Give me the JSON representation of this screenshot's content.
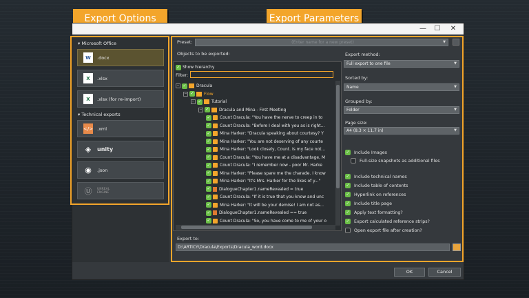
{
  "callouts": {
    "export_options": "Export Options",
    "export_parameters": "Export Parameters"
  },
  "window": {
    "minimize": "—",
    "maximize": "☐",
    "close": "✕"
  },
  "left": {
    "office_head": "▾ Microsoft Office",
    "technical_head": "▾ Technical exports",
    "formats": [
      {
        "label": ".docx",
        "icon": "word-icon"
      },
      {
        "label": ".xlsx",
        "icon": "excel-icon"
      },
      {
        "label": ".xlsx (for re-import)",
        "icon": "excel-icon"
      },
      {
        "label": ".xml",
        "icon": "xml-icon"
      },
      {
        "label": "unity",
        "icon": "unity-icon"
      },
      {
        "label": ".json",
        "icon": "json-icon"
      },
      {
        "label": "UNREAL ENGINE",
        "icon": "unreal-icon"
      }
    ]
  },
  "preset": {
    "label": "Preset:",
    "placeholder": "(Enter name for a new preset)"
  },
  "objects": {
    "label": "Objects to be exported:",
    "show_hierarchy": "Show hierarchy",
    "filter_label": "Filter:"
  },
  "tree": [
    {
      "level": 0,
      "pm": "⊟",
      "icon": "project",
      "text": "Dracula"
    },
    {
      "level": 1,
      "pm": "⊟",
      "icon": "flow",
      "text": "Flow",
      "orange": true
    },
    {
      "level": 2,
      "pm": "⊟",
      "icon": "folder",
      "text": "Tutorial"
    },
    {
      "level": 3,
      "pm": "⊟",
      "icon": "dialogue",
      "text": "Dracula and Mina - First Meeting"
    },
    {
      "level": 4,
      "icon": "line",
      "text": "Count Dracula: \"You have the nerve to creep in to"
    },
    {
      "level": 4,
      "icon": "line",
      "text": "Count Dracula: \"Before I deal with you as is right..."
    },
    {
      "level": 4,
      "icon": "line",
      "text": "Mina Harker: \"Dracula speaking about courtesy? Y"
    },
    {
      "level": 4,
      "icon": "line",
      "text": "Mina Harker: \"You are not deserving of any courte"
    },
    {
      "level": 4,
      "icon": "line",
      "text": "Mina Harker: \"Look closely, Count. Is my face not..."
    },
    {
      "level": 4,
      "icon": "line",
      "text": "Count Dracula: \"You have me at a disadvantage, M"
    },
    {
      "level": 4,
      "icon": "line",
      "text": "Count Dracula: \"I remember now - poor Mr. Harke"
    },
    {
      "level": 4,
      "icon": "line",
      "text": "Mina Harker: \"Please spare me the charade. I know"
    },
    {
      "level": 4,
      "icon": "line",
      "text": "Mina Harker: \"It's Mrs. Harker for the likes of y...\""
    },
    {
      "level": 4,
      "icon": "instr",
      "text": "DialogueChapter1.nameRevealed = true"
    },
    {
      "level": 4,
      "icon": "line",
      "text": "Count Dracula: \"If it is true that you know and unc"
    },
    {
      "level": 4,
      "icon": "line",
      "text": "Mina Harker: \"It will be your demise! I am not as..."
    },
    {
      "level": 4,
      "icon": "cond",
      "text": "DialogueChapter1.nameRevealed == true"
    },
    {
      "level": 4,
      "icon": "line",
      "text": "Count Dracula: \"So, you have come to me of your o"
    }
  ],
  "export_to": {
    "label": "Export to:",
    "path": "D:\\ARTICY\\Dracula\\Exports\\Dracula_word.docx"
  },
  "method": {
    "label": "Export method:",
    "value": "Full export to one file"
  },
  "sorted": {
    "label": "Sorted by:",
    "value": "Name"
  },
  "grouped": {
    "label": "Grouped by:",
    "value": "Folder"
  },
  "page": {
    "label": "Page size:",
    "value": "A4 (8.3 × 11.7 in)"
  },
  "options": [
    {
      "text": "Include Images",
      "checked": true,
      "indent": 0
    },
    {
      "text": "Full-size snapshots as additional files",
      "checked": false,
      "indent": 1
    },
    {
      "text": "Include technical names",
      "checked": true,
      "indent": 0
    },
    {
      "text": "Include table of contents",
      "checked": true,
      "indent": 0
    },
    {
      "text": "Hyperlink on references",
      "checked": true,
      "indent": 0
    },
    {
      "text": "Include title page",
      "checked": true,
      "indent": 0
    },
    {
      "text": "Apply text formatting?",
      "checked": true,
      "indent": 0
    },
    {
      "text": "Export calculated reference strips?",
      "checked": true,
      "indent": 0
    },
    {
      "text": "Open export file after creation?",
      "checked": false,
      "indent": 0
    }
  ],
  "buttons": {
    "ok": "OK",
    "cancel": "Cancel"
  },
  "colors": {
    "accent": "#f3a52b",
    "check": "#6bbf47"
  }
}
